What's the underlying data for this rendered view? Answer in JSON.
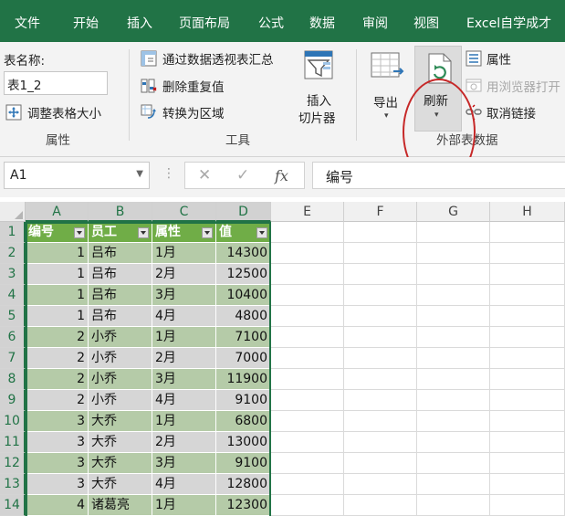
{
  "tabs": [
    "文件",
    "开始",
    "插入",
    "页面布局",
    "公式",
    "数据",
    "审阅",
    "视图",
    "Excel自学成才"
  ],
  "ribbon": {
    "properties_group": {
      "table_name_label": "表名称:",
      "table_name_value": "表1_2",
      "resize_label": "调整表格大小",
      "group_label": "属性"
    },
    "tools_group": {
      "pivot_label": "通过数据透视表汇总",
      "remove_dup_label": "删除重复值",
      "convert_label": "转换为区域",
      "slicer_label_1": "插入",
      "slicer_label_2": "切片器",
      "group_label": "工具"
    },
    "external_group": {
      "export_label": "导出",
      "refresh_label": "刷新",
      "properties_label": "属性",
      "open_browser_label": "用浏览器打开",
      "unlink_label": "取消链接",
      "group_label": "外部表数据"
    }
  },
  "formula_bar": {
    "name_box": "A1",
    "formula": "编号"
  },
  "grid": {
    "columns": [
      "A",
      "B",
      "C",
      "D",
      "E",
      "F",
      "G",
      "H"
    ],
    "rows": [
      "1",
      "2",
      "3",
      "4",
      "5",
      "6",
      "7",
      "8",
      "9",
      "10",
      "11",
      "12",
      "13",
      "14"
    ]
  },
  "table": {
    "headers": [
      "编号",
      "员工",
      "属性",
      "值"
    ],
    "rows": [
      [
        "1",
        "吕布",
        "1月",
        "14300"
      ],
      [
        "1",
        "吕布",
        "2月",
        "12500"
      ],
      [
        "1",
        "吕布",
        "3月",
        "10400"
      ],
      [
        "1",
        "吕布",
        "4月",
        "4800"
      ],
      [
        "2",
        "小乔",
        "1月",
        "7100"
      ],
      [
        "2",
        "小乔",
        "2月",
        "7000"
      ],
      [
        "2",
        "小乔",
        "3月",
        "11900"
      ],
      [
        "2",
        "小乔",
        "4月",
        "9100"
      ],
      [
        "3",
        "大乔",
        "1月",
        "6800"
      ],
      [
        "3",
        "大乔",
        "2月",
        "13000"
      ],
      [
        "3",
        "大乔",
        "3月",
        "9100"
      ],
      [
        "3",
        "大乔",
        "4月",
        "12800"
      ],
      [
        "4",
        "诸葛亮",
        "1月",
        "12300"
      ]
    ]
  },
  "colors": {
    "ribbon_green": "#217346",
    "table_header": "#70ad47",
    "band_green": "#b5cba8",
    "band_gray": "#d6d6d6",
    "highlight_circle": "#c62828"
  }
}
